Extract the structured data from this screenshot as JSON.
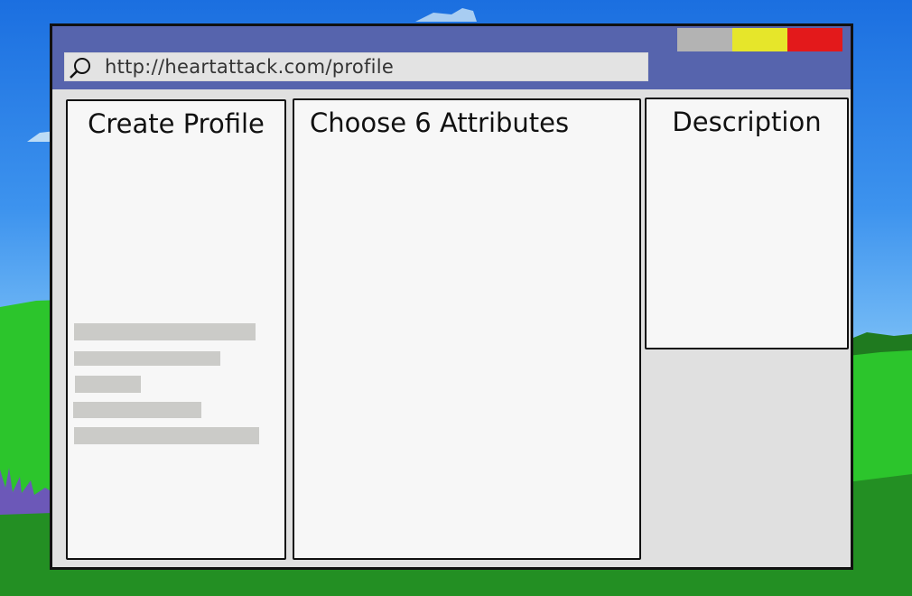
{
  "window": {
    "address_url": "http://heartattack.com/profile",
    "icons": {
      "search": "search-icon"
    },
    "controls": {
      "minimize_color": "#b3b3b3",
      "maximize_color": "#e6e62a",
      "close_color": "#e3191b"
    }
  },
  "panels": {
    "create_profile": {
      "title": "Create Profile"
    },
    "attributes": {
      "title": "Choose 6 Attributes"
    },
    "description": {
      "title": "Description"
    }
  },
  "colors": {
    "titlebar": "#5664ad",
    "sky": "#2f86ea",
    "grass": "#2fc72f",
    "panel_bg": "#f7f7f7",
    "placeholder": "#cbcbc8"
  }
}
